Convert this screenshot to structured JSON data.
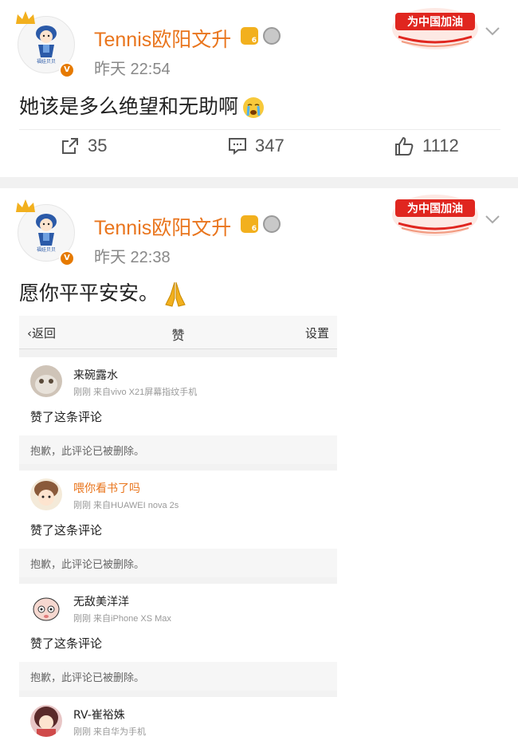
{
  "posts": [
    {
      "username": "Tennis欧阳文升",
      "time": "昨天 22:54",
      "stamp_text": "为中国加油",
      "content": "她该是多么绝望和无助啊",
      "content_emoji": "crying-face",
      "avatar_caption": "福娃贝贝",
      "actions": {
        "repost": "35",
        "comment": "347",
        "like": "1112"
      }
    },
    {
      "username": "Tennis欧阳文升",
      "time": "昨天 22:38",
      "stamp_text": "为中国加油",
      "content": "愿你平平安安。",
      "content_emoji": "folded-hands",
      "avatar_caption": "福娃贝贝"
    }
  ],
  "embedded": {
    "nav": {
      "back": "返回",
      "title": "赞",
      "settings": "设置"
    },
    "notifications": [
      {
        "name": "来碗露水",
        "vip": false,
        "meta": "刚刚 来自vivo X21屏幕指纹手机",
        "body": "赞了这条评论",
        "deleted": "抱歉，此评论已被删除。",
        "avatar": "cat"
      },
      {
        "name": "喂你看书了吗",
        "vip": true,
        "meta": "刚刚 来自HUAWEI nova 2s",
        "body": "赞了这条评论",
        "deleted": "抱歉，此评论已被删除。",
        "avatar": "cartoon-girl"
      },
      {
        "name": "无敌美洋洋",
        "vip": false,
        "meta": "刚刚 来自iPhone XS Max",
        "body": "赞了这条评论",
        "deleted": "抱歉，此评论已被删除。",
        "avatar": "cartoon-face"
      },
      {
        "name": "RV-崔裕姝",
        "vip": false,
        "meta": "刚刚 来自华为手机",
        "avatar": "photo-girl"
      }
    ]
  },
  "colors": {
    "accent": "#e9751d",
    "vip_badge": "#e67a00",
    "stamp_red": "#e0261f"
  }
}
